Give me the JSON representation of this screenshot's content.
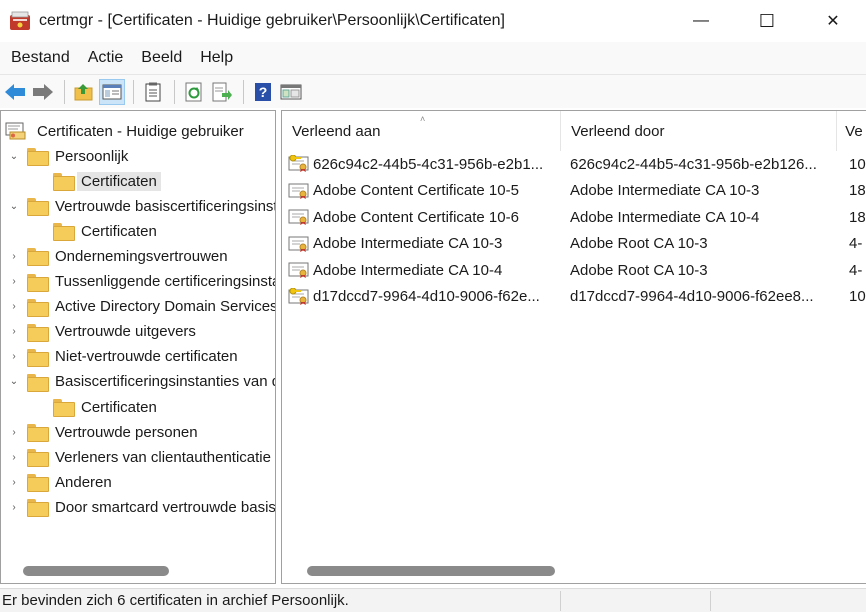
{
  "window": {
    "title": "certmgr - [Certificaten - Huidige gebruiker\\Persoonlijk\\Certificaten]",
    "minimize_glyph": "—",
    "maximize_glyph": "☐",
    "close_glyph": "✕"
  },
  "menu": [
    "Bestand",
    "Actie",
    "Beeld",
    "Help"
  ],
  "toolbar": {
    "buttons": [
      "back-icon",
      "forward-icon",
      "up-folder-icon",
      "show-hide-tree-icon",
      "properties-icon",
      "refresh-icon",
      "export-list-icon",
      "help-icon",
      "mmc-view-icon"
    ]
  },
  "tree": {
    "root": "Certificaten - Huidige gebruiker",
    "items": [
      {
        "label": "Persoonlijk",
        "level": 1,
        "expander": "⌄"
      },
      {
        "label": "Certificaten",
        "level": 2,
        "expander": "",
        "selected": true
      },
      {
        "label": "Vertrouwde basiscertificeringsinstanties",
        "level": 1,
        "expander": "⌄"
      },
      {
        "label": "Certificaten",
        "level": 2,
        "expander": ""
      },
      {
        "label": "Ondernemingsvertrouwen",
        "level": 1,
        "expander": "›"
      },
      {
        "label": "Tussenliggende certificeringsinstanties",
        "level": 1,
        "expander": "›"
      },
      {
        "label": "Active Directory Domain Services",
        "level": 1,
        "expander": "›"
      },
      {
        "label": "Vertrouwde uitgevers",
        "level": 1,
        "expander": "›"
      },
      {
        "label": "Niet-vertrouwde certificaten",
        "level": 1,
        "expander": "›"
      },
      {
        "label": "Basiscertificeringsinstanties van derden",
        "level": 1,
        "expander": "⌄"
      },
      {
        "label": "Certificaten",
        "level": 2,
        "expander": ""
      },
      {
        "label": "Vertrouwde personen",
        "level": 1,
        "expander": "›"
      },
      {
        "label": "Verleners van clientauthenticatie",
        "level": 1,
        "expander": "›"
      },
      {
        "label": "Anderen",
        "level": 1,
        "expander": "›"
      },
      {
        "label": "Door smartcard vertrouwde basiscertificaten",
        "level": 1,
        "expander": "›"
      }
    ]
  },
  "list": {
    "columns": [
      "Verleend aan",
      "Verleend door",
      "Ve"
    ],
    "sort_glyph": "˄",
    "rows": [
      {
        "issued_to": "626c94c2-44b5-4c31-956b-e2b1...",
        "issued_by": "626c94c2-44b5-4c31-956b-e2b126...",
        "expires": "10",
        "icon": "key-certificate-icon"
      },
      {
        "issued_to": "Adobe Content Certificate 10-5",
        "issued_by": "Adobe Intermediate CA 10-3",
        "expires": "18",
        "icon": "certificate-icon"
      },
      {
        "issued_to": "Adobe Content Certificate 10-6",
        "issued_by": "Adobe Intermediate CA 10-4",
        "expires": "18",
        "icon": "certificate-icon"
      },
      {
        "issued_to": "Adobe Intermediate CA 10-3",
        "issued_by": "Adobe Root CA 10-3",
        "expires": "4-",
        "icon": "certificate-icon"
      },
      {
        "issued_to": "Adobe Intermediate CA 10-4",
        "issued_by": "Adobe Root CA 10-3",
        "expires": "4-",
        "icon": "certificate-icon"
      },
      {
        "issued_to": "d17dccd7-9964-4d10-9006-f62e...",
        "issued_by": "d17dccd7-9964-4d10-9006-f62ee8...",
        "expires": "10",
        "icon": "key-certificate-icon"
      }
    ]
  },
  "status": {
    "text": "Er bevinden zich 6 certificaten in archief Persoonlijk."
  },
  "colors": {
    "selection": "#e5e5e5",
    "folder": "#f5cc5a",
    "scrollbar": "#8a8a8a"
  }
}
